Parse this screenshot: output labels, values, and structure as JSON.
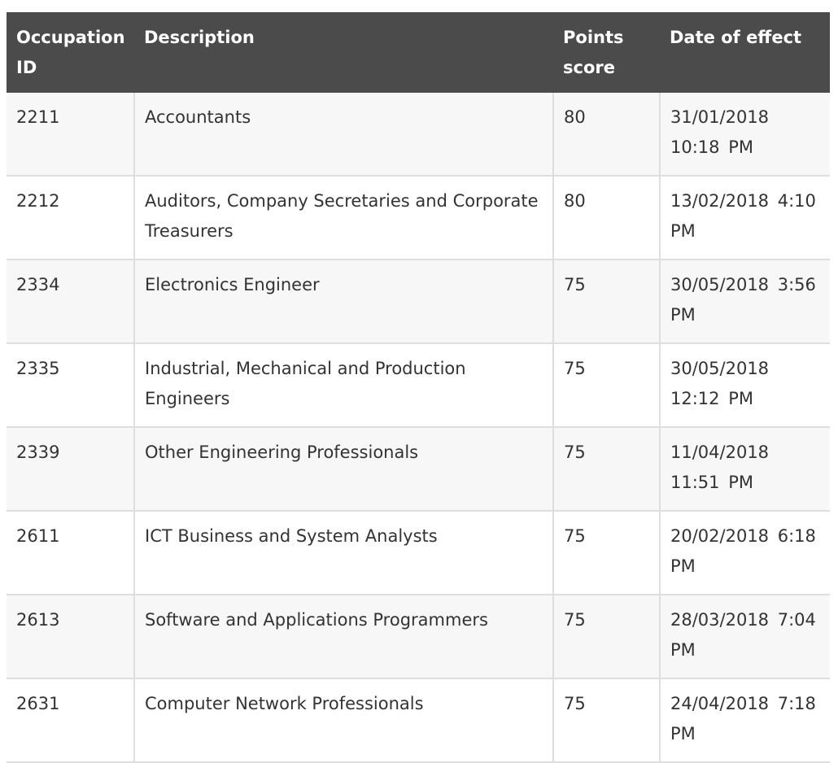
{
  "table": {
    "headers": [
      "Occupation ID",
      "Description",
      "Points score",
      "Date of effect"
    ],
    "rows": [
      [
        "2211",
        "Accountants",
        "80",
        "31/01/2018 10:18 PM"
      ],
      [
        "2212",
        "Auditors, Company Secretaries and Corporate Treasurers",
        "80",
        "13/02/2018 4:10 PM"
      ],
      [
        "2334",
        "Electronics Engineer",
        "75",
        "30/05/2018 3:56 PM"
      ],
      [
        "2335",
        "Industrial, Mechanical and Production Engineers",
        "75",
        "30/05/2018 12:12 PM"
      ],
      [
        "2339",
        "Other Engineering Professionals",
        "75",
        "11/04/2018 11:51 PM"
      ],
      [
        "2611",
        "ICT Business and System Analysts",
        "75",
        "20/02/2018 6:18 PM"
      ],
      [
        "2613",
        "Software and Applications Programmers",
        "75",
        "28/03/2018 7:04 PM"
      ],
      [
        "2631",
        "Computer Network Professionals",
        "75",
        "24/04/2018 7:18 PM"
      ]
    ]
  }
}
